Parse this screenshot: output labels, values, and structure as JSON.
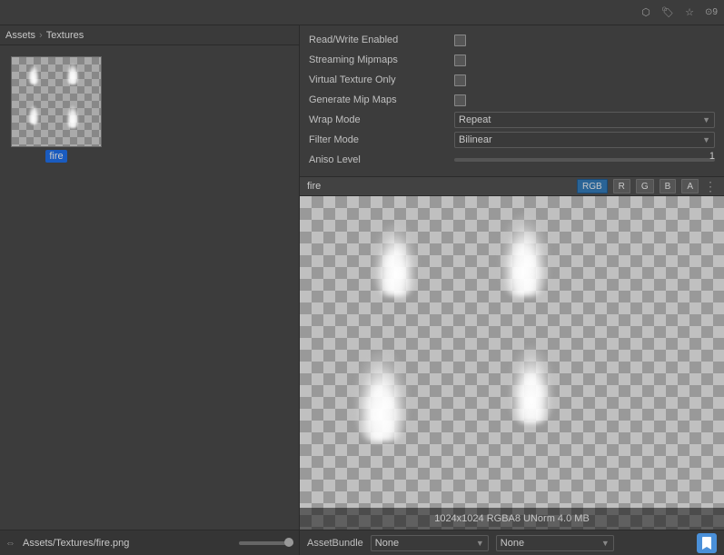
{
  "topbar": {
    "icons": [
      "cursor-icon",
      "tag-icon",
      "star-icon",
      "layers-icon"
    ],
    "layers_count": "9"
  },
  "breadcrumb": {
    "root": "Assets",
    "separator": "›",
    "current": "Textures"
  },
  "asset": {
    "name": "fire",
    "label": "fire"
  },
  "inspector": {
    "props": [
      {
        "label": "Read/Write Enabled",
        "type": "checkbox",
        "checked": false
      },
      {
        "label": "Streaming Mipmaps",
        "type": "checkbox",
        "checked": false
      },
      {
        "label": "Virtual Texture Only",
        "type": "checkbox",
        "checked": false
      },
      {
        "label": "Generate Mip Maps",
        "type": "checkbox",
        "checked": false
      }
    ],
    "wrap_mode": {
      "label": "Wrap Mode",
      "value": "Repeat"
    },
    "filter_mode": {
      "label": "Filter Mode",
      "value": "Bilinear"
    },
    "aniso": {
      "label": "Aniso Level",
      "value": "1"
    }
  },
  "preview": {
    "name": "fire",
    "channels": [
      "RGB",
      "R",
      "G",
      "B",
      "A"
    ],
    "active_channel": "RGB",
    "info": "1024x1024  RGBA8 UNorm  4.0 MB"
  },
  "asset_bundle": {
    "label": "AssetBundle",
    "value": "None",
    "variant_value": "None"
  },
  "bottom_bar": {
    "path": "Assets/Textures/fire.png"
  }
}
